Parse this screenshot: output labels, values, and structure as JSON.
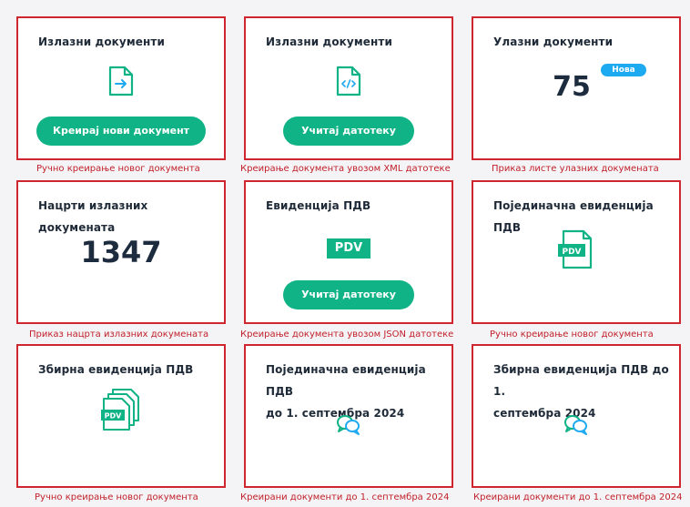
{
  "colors": {
    "accent": "#10b386",
    "badge": "#1eaaf1",
    "highlight_border": "#d0262f",
    "caption_text": "#c2202a",
    "title_text": "#1f2a38"
  },
  "cards": {
    "outgoing_create": {
      "title": "Излазни документи",
      "icon": "file-arrow-icon",
      "button_label": "Креирај нови документ",
      "caption": "Ручно креирање новог документа"
    },
    "outgoing_xml": {
      "title": "Излазни документи",
      "icon": "file-xml-icon",
      "button_label": "Учитај датотеку",
      "caption": "Креирање документа увозом XML датотеке"
    },
    "incoming": {
      "title": "Улазни документи",
      "count": "75",
      "badge": "Нова",
      "caption": "Приказ листе улазних докумената"
    },
    "drafts": {
      "title": "Нацрти излазних докумената",
      "count": "1347",
      "caption": "Приказ нацрта излазних докумената"
    },
    "vat_records": {
      "title": "Евиденција ПДВ",
      "icon_label": "PDV",
      "button_label": "Учитај датотеку",
      "caption": "Креирање документа увозом JSON датотеке"
    },
    "individual_vat": {
      "title": "Појединачна евиденција ПДВ",
      "icon_label": "PDV",
      "caption": "Ручно креирање новог документа"
    },
    "summary_vat": {
      "title": "Збирна евиденција ПДВ",
      "icon_label": "PDV",
      "caption": "Ручно креирање новог документа"
    },
    "individual_vat_pre": {
      "title_line1": "Појединачна евиденција ПДВ",
      "title_line2": "до 1. септембра 2024",
      "icon": "chat-bubbles-icon",
      "caption": "Креирани документи до 1. септембра 2024"
    },
    "summary_vat_pre": {
      "title_line1": "Збирна евиденција ПДВ до 1.",
      "title_line2": "септембра 2024",
      "icon": "chat-bubbles-icon",
      "caption": "Креирани документи до 1. септембра 2024"
    }
  }
}
